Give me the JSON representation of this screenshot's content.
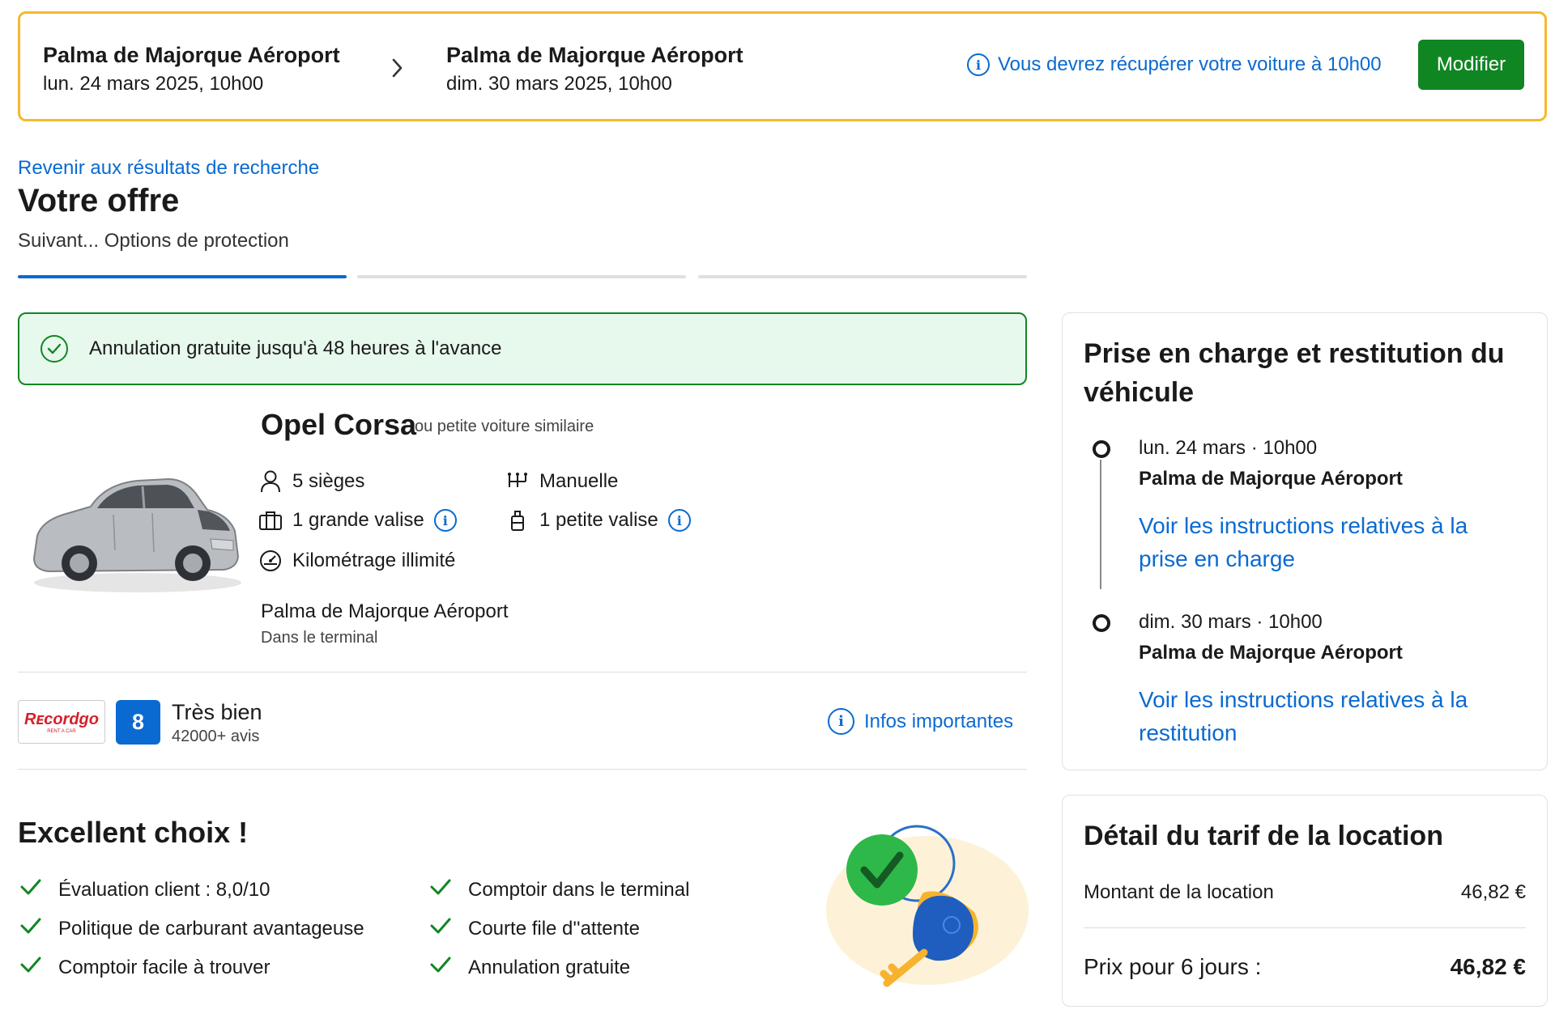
{
  "topbar": {
    "pickup_location": "Palma de Majorque Aéroport",
    "pickup_datetime": "lun. 24 mars 2025, 10h00",
    "return_location": "Palma de Majorque Aéroport",
    "return_datetime": "dim. 30 mars 2025, 10h00",
    "info_text": "Vous devrez récupérer votre voiture à 10h00",
    "modify_label": "Modifier"
  },
  "header": {
    "back_link": "Revenir aux résultats de recherche",
    "title": "Votre offre",
    "subtitle": "Suivant... Options de protection"
  },
  "progress": {
    "steps": 3,
    "current": 1
  },
  "cancellation": {
    "text": "Annulation gratuite jusqu'à 48 heures à l'avance"
  },
  "car": {
    "name": "Opel Corsa",
    "similar": "ou petite voiture similaire",
    "features": {
      "seats": "5 sièges",
      "transmission": "Manuelle",
      "large_bag": "1 grande valise",
      "small_bag": "1 petite valise",
      "mileage": "Kilométrage illimité"
    },
    "location": "Palma de Majorque Aéroport",
    "location_detail": "Dans le terminal"
  },
  "supplier": {
    "logo_text": "Rᴇcordgo",
    "logo_tagline": "RENT A CAR",
    "score": "8",
    "rating_label": "Très bien",
    "review_count": "42000+ avis",
    "info_link": "Infos importantes"
  },
  "highlights": {
    "title": "Excellent choix !",
    "left": [
      "Évaluation client : 8,0/10",
      "Politique de carburant avantageuse",
      "Comptoir facile à trouver"
    ],
    "right": [
      "Comptoir dans le terminal",
      "Courte file d''attente",
      "Annulation gratuite"
    ]
  },
  "pickup_card": {
    "title": "Prise en charge et restitution du véhicule",
    "pickup_date": "lun. 24 mars · 10h00",
    "pickup_location": "Palma de Majorque Aéroport",
    "pickup_link": "Voir les instructions relatives à la prise en charge",
    "return_date": "dim. 30 mars · 10h00",
    "return_location": "Palma de Majorque Aéroport",
    "return_link": "Voir les instructions relatives à la restitution"
  },
  "price_card": {
    "title": "Détail du tarif de la location",
    "rental_label": "Montant de la location",
    "rental_amount": "46,82 €",
    "total_label": "Prix pour 6 jours :",
    "total_amount": "46,82 €"
  },
  "colors": {
    "accent_blue": "#0a6ad1",
    "brand_green": "#108623",
    "topbar_border": "#f5b92e",
    "success_bg": "#e7f8ed"
  }
}
